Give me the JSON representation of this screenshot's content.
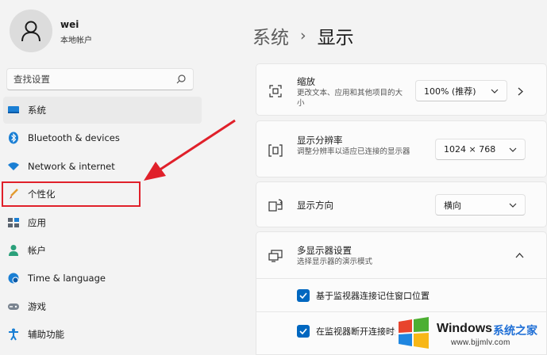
{
  "account": {
    "name": "wei",
    "type": "本地帐户"
  },
  "search": {
    "placeholder": "查找设置"
  },
  "nav": {
    "items": [
      {
        "label": "系统",
        "icon": "monitor-icon"
      },
      {
        "label": "Bluetooth & devices",
        "icon": "bluetooth-icon"
      },
      {
        "label": "Network & internet",
        "icon": "wifi-icon"
      },
      {
        "label": "个性化",
        "icon": "brush-icon"
      },
      {
        "label": "应用",
        "icon": "apps-icon"
      },
      {
        "label": "帐户",
        "icon": "person-icon"
      },
      {
        "label": "Time & language",
        "icon": "globe-clock-icon"
      },
      {
        "label": "游戏",
        "icon": "gamepad-icon"
      },
      {
        "label": "辅助功能",
        "icon": "accessibility-icon"
      }
    ],
    "selected_index": 0,
    "highlighted_index": 3
  },
  "breadcrumb": {
    "parent": "系统",
    "separator": "›",
    "current": "显示"
  },
  "settings": {
    "scale": {
      "title": "缩放",
      "desc": "更改文本、应用和其他项目的大小",
      "value": "100% (推荐)",
      "icon": "scale-icon"
    },
    "resolution": {
      "title": "显示分辨率",
      "desc": "调整分辨率以适应已连接的显示器",
      "value": "1024 × 768",
      "icon": "resolution-icon"
    },
    "orientation": {
      "title": "显示方向",
      "value": "横向",
      "icon": "orientation-icon"
    },
    "multi_display": {
      "title": "多显示器设置",
      "desc": "选择显示器的演示模式",
      "icon": "multi-display-icon",
      "options": [
        {
          "label": "基于监视器连接记住窗口位置",
          "checked": true
        },
        {
          "label": "在监视器断开连接时最小化窗口",
          "checked": true
        }
      ]
    }
  },
  "watermark": {
    "brand": "Windows",
    "site_cn": "系统之家",
    "url": "www.bjjmlv.com"
  },
  "colors": {
    "accent": "#0067c0",
    "annotation": "#e0202a",
    "background": "#f3f3f3",
    "card": "#fbfbfb"
  }
}
